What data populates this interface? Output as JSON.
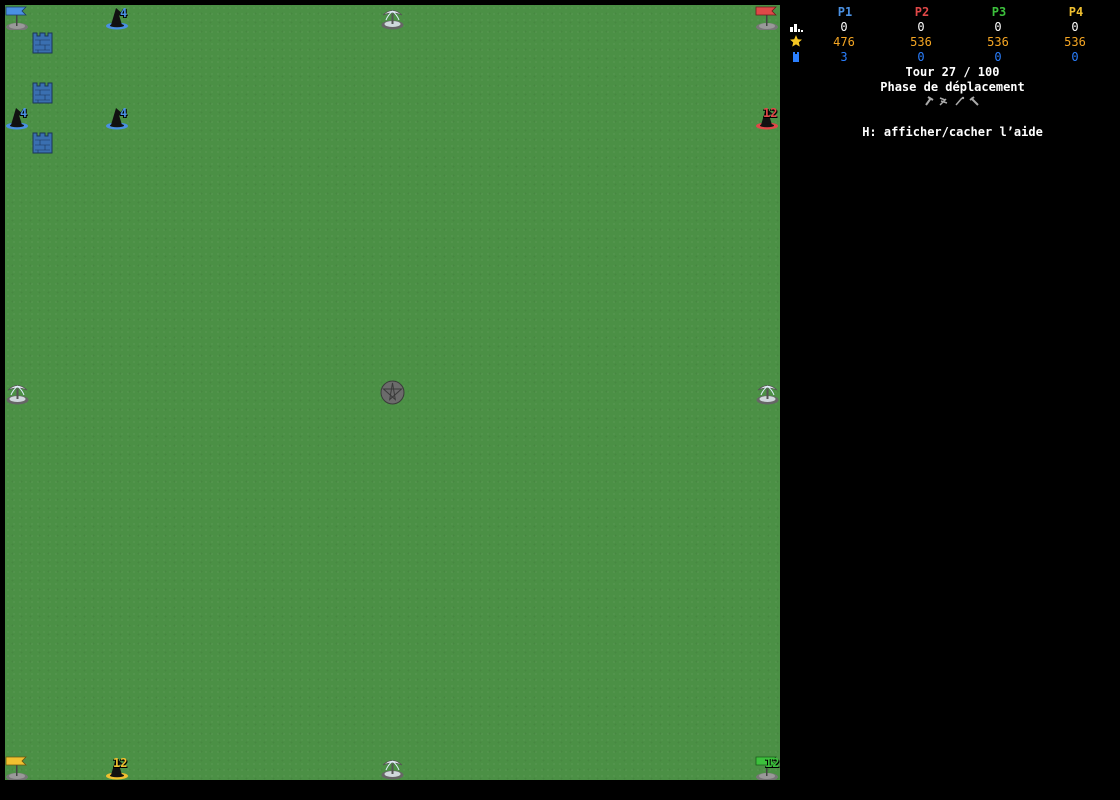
{
  "players": [
    {
      "label": "P1",
      "color": "#4a90e2",
      "row1": "0",
      "row2": "476",
      "row3": "3"
    },
    {
      "label": "P2",
      "color": "#e04848",
      "row1": "0",
      "row2": "536",
      "row3": "0"
    },
    {
      "label": "P3",
      "color": "#3cc03c",
      "row1": "0",
      "row2": "536",
      "row3": "0"
    },
    {
      "label": "P4",
      "color": "#f0c030",
      "row1": "0",
      "row2": "536",
      "row3": "0"
    }
  ],
  "rows": {
    "row1_icon": "buildings-icon",
    "row2_icon": "star-icon",
    "row3_icon": "tower-icon",
    "row1_color": "#ffffff",
    "row2_color": "#f5a623",
    "row3_color": "#2a7fff"
  },
  "turn_text": "Tour 27 / 100",
  "phase_text": "Phase de déplacement",
  "help_text": "H: afficher/cacher l’aide",
  "board": {
    "wizards": [
      {
        "owner": "P1",
        "count": "4",
        "color": "#4a90e2"
      },
      {
        "owner": "P1",
        "count": "4",
        "color": "#4a90e2"
      },
      {
        "owner": "P1",
        "count": "4",
        "color": "#4a90e2"
      },
      {
        "owner": "P2",
        "count": "12",
        "color": "#e04848"
      },
      {
        "owner": "P4",
        "count": "12",
        "color": "#f0c030"
      }
    ],
    "green_base_count": "12",
    "flags": [
      {
        "owner": "P1",
        "color": "#4a90e2"
      },
      {
        "owner": "P2",
        "color": "#e04848"
      },
      {
        "owner": "P4",
        "color": "#f0c030"
      },
      {
        "owner": "P3",
        "color": "#3cc03c"
      }
    ],
    "tower_color": "#3a6fb0"
  }
}
